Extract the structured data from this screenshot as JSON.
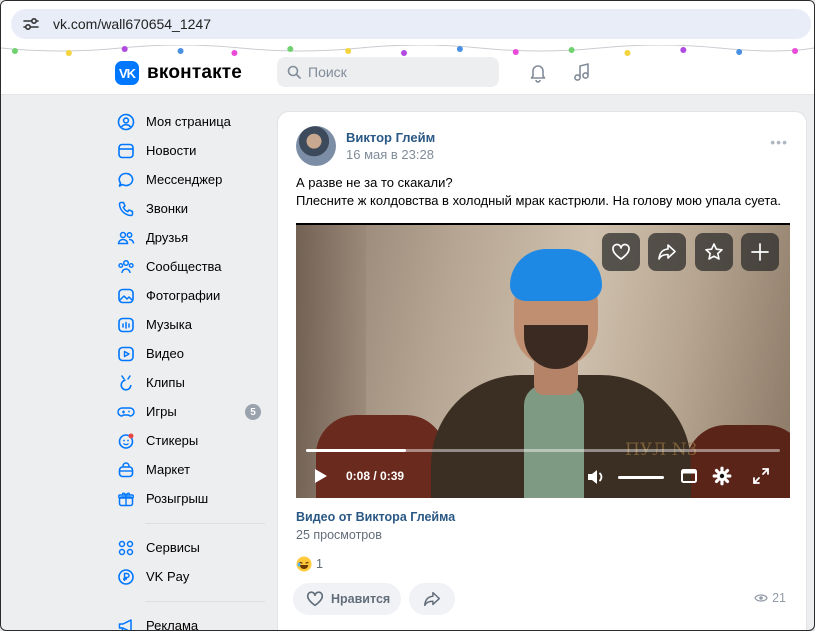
{
  "browser": {
    "url": "vk.com/wall670654_1247"
  },
  "header": {
    "logo_mark": "VK",
    "logo_text": "вконтакте",
    "search_placeholder": "Поиск"
  },
  "sidebar": {
    "items": [
      {
        "label": "Моя страница",
        "icon": "user-circle-icon"
      },
      {
        "label": "Новости",
        "icon": "news-icon"
      },
      {
        "label": "Мессенджер",
        "icon": "message-icon"
      },
      {
        "label": "Звонки",
        "icon": "phone-icon"
      },
      {
        "label": "Друзья",
        "icon": "friends-icon"
      },
      {
        "label": "Сообщества",
        "icon": "communities-icon"
      },
      {
        "label": "Фотографии",
        "icon": "photo-icon"
      },
      {
        "label": "Музыка",
        "icon": "music-icon"
      },
      {
        "label": "Видео",
        "icon": "video-icon"
      },
      {
        "label": "Клипы",
        "icon": "clips-icon"
      },
      {
        "label": "Игры",
        "icon": "gamepad-icon",
        "badge": "5"
      },
      {
        "label": "Стикеры",
        "icon": "sticker-icon"
      },
      {
        "label": "Маркет",
        "icon": "market-bag-icon"
      },
      {
        "label": "Розыгрыш",
        "icon": "gift-icon"
      }
    ],
    "extra": [
      {
        "label": "Сервисы",
        "icon": "services-icon"
      },
      {
        "label": "VK Pay",
        "icon": "vkpay-icon"
      }
    ],
    "bottom": [
      {
        "label": "Реклама",
        "icon": "ads-megaphone-icon"
      }
    ]
  },
  "post": {
    "author": "Виктор Глейм",
    "date": "16 мая в 23:28",
    "more": "•••",
    "text_line1": "А разве не за то скакали?",
    "text_line2": "Плесните ж колдовства в холодный мрак кастрюли. На голову мою упала суета.",
    "video": {
      "time": "0:08 / 0:39",
      "progress": 0.21,
      "watermark": "ПУЛ N3"
    },
    "video_title": "Видео от Виктора Глейма",
    "video_views": "25 просмотров",
    "reaction_count": "1",
    "like_label": "Нравится",
    "views_count": "21"
  },
  "colors": {
    "accent": "#0077ff",
    "link": "#2a5885",
    "secondary_text": "#818c99"
  }
}
